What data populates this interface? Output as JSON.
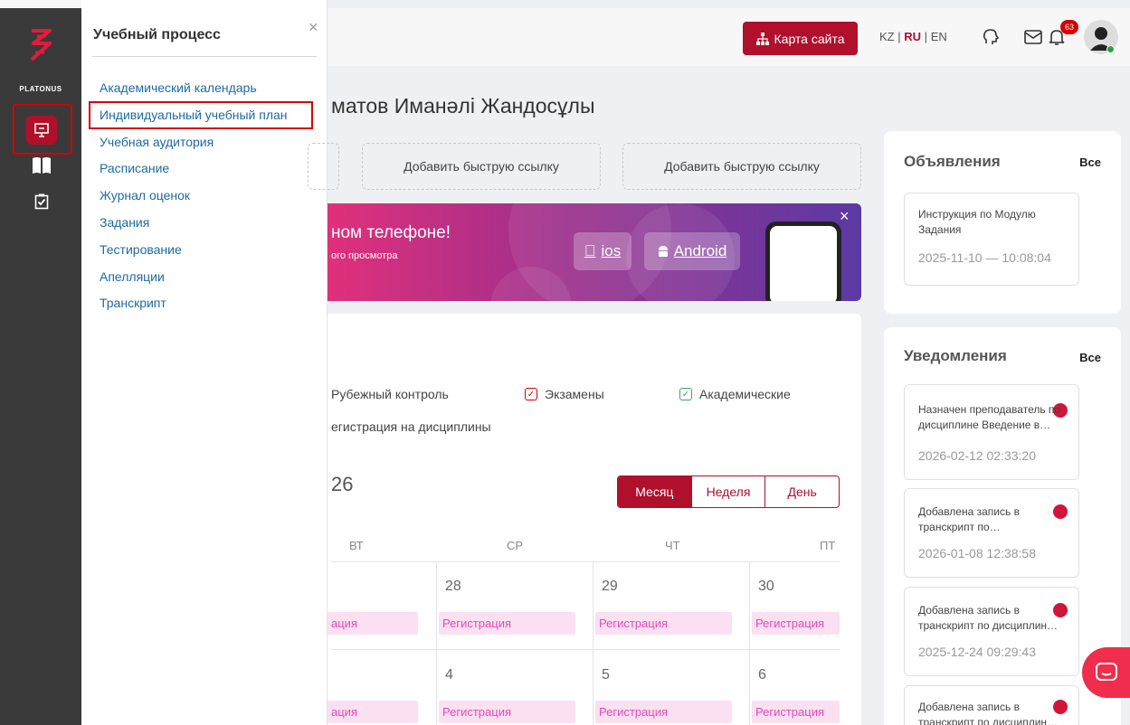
{
  "brand": {
    "logo_text": "PLATONUS"
  },
  "menu": {
    "title": "Учебный процесс",
    "close_icon": "×",
    "items": [
      "Академический календарь",
      "Индивидуальный учебный план",
      "Учебная аудитория",
      "Расписание",
      "Журнал оценок",
      "Задания",
      "Тестирование",
      "Апелляции",
      "Транскрипт"
    ]
  },
  "header": {
    "site_map_label": "Карта сайта",
    "lang_kz": "KZ",
    "lang_ru": "RU",
    "lang_en": "EN",
    "lang_sep": "|",
    "notification_count": "63"
  },
  "main": {
    "user_name": "матов Иманәлі Жандосұлы",
    "quick_links": [
      "Добавить быструю ссылку",
      "Добавить быструю ссылку"
    ],
    "banner": {
      "title": "ном телефоне!",
      "subtitle": "ого просмотра",
      "ios_label": "ios",
      "android_label": "Android"
    },
    "legend": {
      "midterm": "Рубежный контроль",
      "exams": "Экзамены",
      "academic": "Академические",
      "registration": "егистрация на дисциплины"
    },
    "year": "26",
    "views": [
      "Месяц",
      "Неделя",
      "День"
    ],
    "weekdays": [
      "ВТ",
      "СР",
      "ЧТ",
      "ПТ"
    ],
    "week1_days": [
      "28",
      "29",
      "30"
    ],
    "week2_days": [
      "4",
      "5",
      "6"
    ],
    "reg_partial": "ация",
    "reg_full": "Регистрация"
  },
  "announcements": {
    "title": "Объявления",
    "all": "Все",
    "items": [
      {
        "text": "Инструкция по Модулю Задания",
        "date": "2025-11-10 — 10:08:04"
      }
    ]
  },
  "notifications": {
    "title": "Уведомления",
    "all": "Все",
    "items": [
      {
        "text": "Назначен преподаватель по дисциплине Введение в…",
        "date": "2026-02-12 02:33:20"
      },
      {
        "text": "Добавлена запись в транскрипт по…",
        "date": "2026-01-08 12:38:58"
      },
      {
        "text": "Добавлена запись в транскрипт по дисциплин…",
        "date": "2025-12-24 09:29:43"
      },
      {
        "text": "Добавлена запись в транскрипт по дисциплин…",
        "date": ""
      }
    ]
  },
  "colors": {
    "brand": "#b0102b",
    "highlight": "#d60000",
    "link": "#1d6aa3",
    "tag_bg": "#fbe0f1",
    "tag_text": "#e14bb7"
  }
}
